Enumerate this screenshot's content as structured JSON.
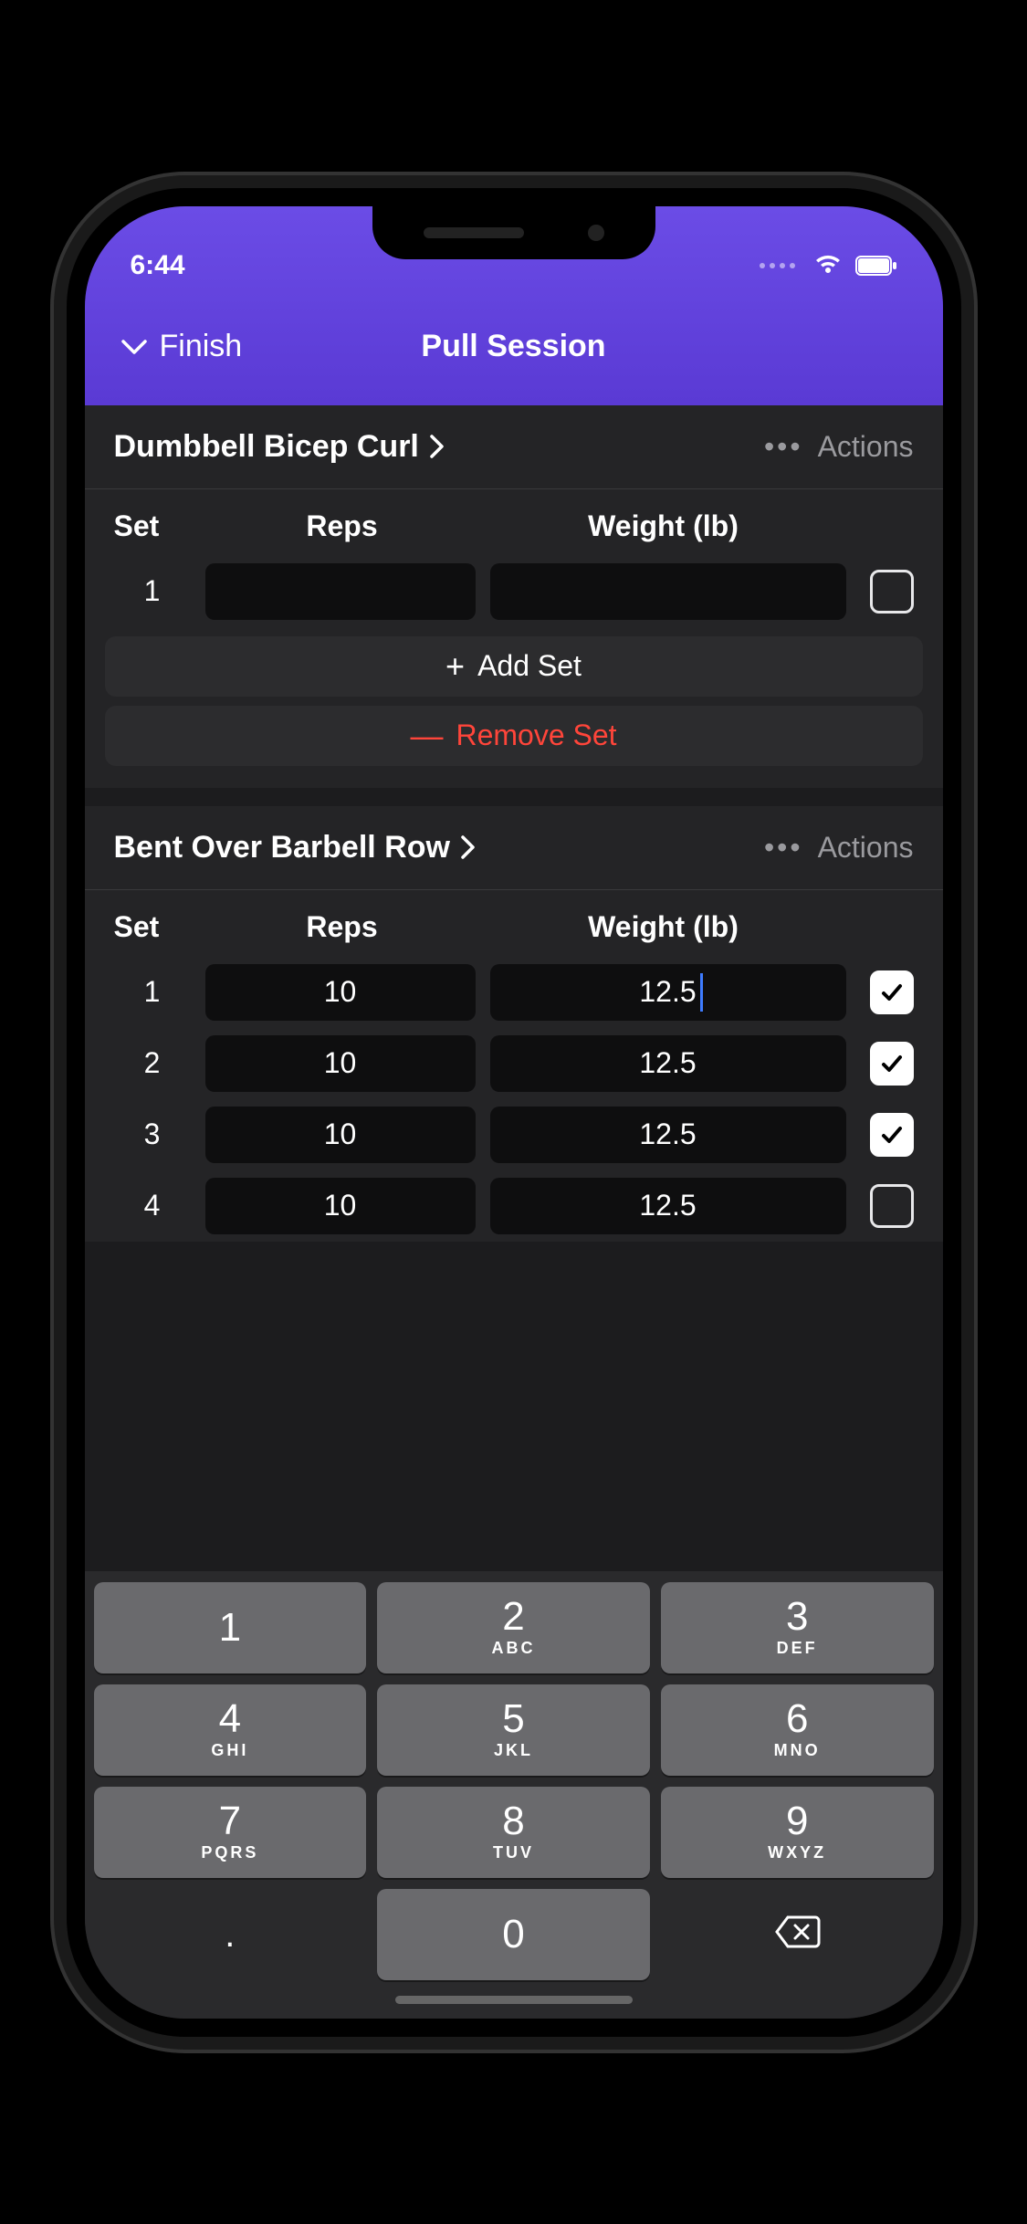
{
  "status": {
    "time": "6:44"
  },
  "nav": {
    "back": "Finish",
    "title": "Pull Session"
  },
  "labels": {
    "actions": "Actions",
    "set": "Set",
    "reps": "Reps",
    "weight": "Weight (lb)",
    "add_set": "Add Set",
    "remove_set": "Remove Set"
  },
  "exercises": [
    {
      "name": "Dumbbell Bicep Curl",
      "sets": [
        {
          "n": "1",
          "reps": "",
          "weight": "",
          "done": false,
          "focused": false
        }
      ]
    },
    {
      "name": "Bent Over Barbell Row",
      "sets": [
        {
          "n": "1",
          "reps": "10",
          "weight": "12.5",
          "done": true,
          "focused": true
        },
        {
          "n": "2",
          "reps": "10",
          "weight": "12.5",
          "done": true,
          "focused": false
        },
        {
          "n": "3",
          "reps": "10",
          "weight": "12.5",
          "done": true,
          "focused": false
        },
        {
          "n": "4",
          "reps": "10",
          "weight": "12.5",
          "done": false,
          "focused": false
        }
      ]
    }
  ],
  "keypad": [
    [
      {
        "n": "1",
        "s": ""
      },
      {
        "n": "2",
        "s": "ABC"
      },
      {
        "n": "3",
        "s": "DEF"
      }
    ],
    [
      {
        "n": "4",
        "s": "GHI"
      },
      {
        "n": "5",
        "s": "JKL"
      },
      {
        "n": "6",
        "s": "MNO"
      }
    ],
    [
      {
        "n": "7",
        "s": "PQRS"
      },
      {
        "n": "8",
        "s": "TUV"
      },
      {
        "n": "9",
        "s": "WXYZ"
      }
    ],
    [
      {
        "n": ".",
        "s": "",
        "fn": true
      },
      {
        "n": "0",
        "s": ""
      },
      {
        "n": "⌫",
        "s": "",
        "fn": true,
        "back": true
      }
    ]
  ]
}
